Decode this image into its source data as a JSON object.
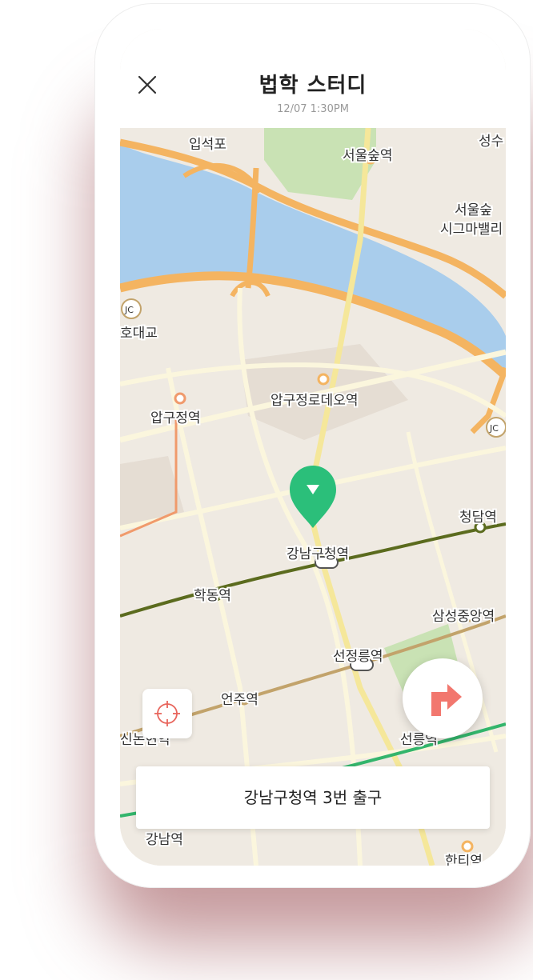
{
  "header": {
    "title": "법학 스터디",
    "datetime": "12/07 1:30PM"
  },
  "map": {
    "labels": {
      "ipseokpo": "입석포",
      "seoulforest": "서울숲역",
      "seongsu": "성수",
      "seoulforest_signature": "서울숲",
      "seoulforest_signature2": "시그마밸리",
      "bridge": "동호대교",
      "ho_bridge": "호대교",
      "apgujeong": "압구정역",
      "apgujeong_rodeo": "압구정로데오역",
      "gangnamgu_office": "강남구청역",
      "cheongdam": "청담역",
      "hakdong": "학동역",
      "samseong_jungang": "삼성중앙역",
      "seonjeongneung": "선정릉역",
      "eonju": "언주역",
      "sinnonhyeon": "신논현역",
      "seolleung": "선릉역",
      "gangnam": "강남역",
      "hanti": "한티역",
      "jc": "JC"
    },
    "colors": {
      "ground": "#efeae2",
      "water": "#a9cdec",
      "park": "#c9e2b4",
      "expressway": "#f4b461",
      "mainroad": "#f5e79a",
      "line7": "#5b6b1e",
      "line9": "#c2a36b",
      "line2": "#33b56c",
      "line3": "#f09a6c",
      "marker": "#2bbf7a"
    }
  },
  "destination": "강남구청역 3번 출구",
  "icons": {
    "close": "close-icon",
    "locate": "crosshair-icon",
    "route": "turn-right-icon",
    "marker": "location-pin-icon"
  },
  "colors": {
    "accent": "#2bbf7a",
    "route": "#f2776e"
  }
}
